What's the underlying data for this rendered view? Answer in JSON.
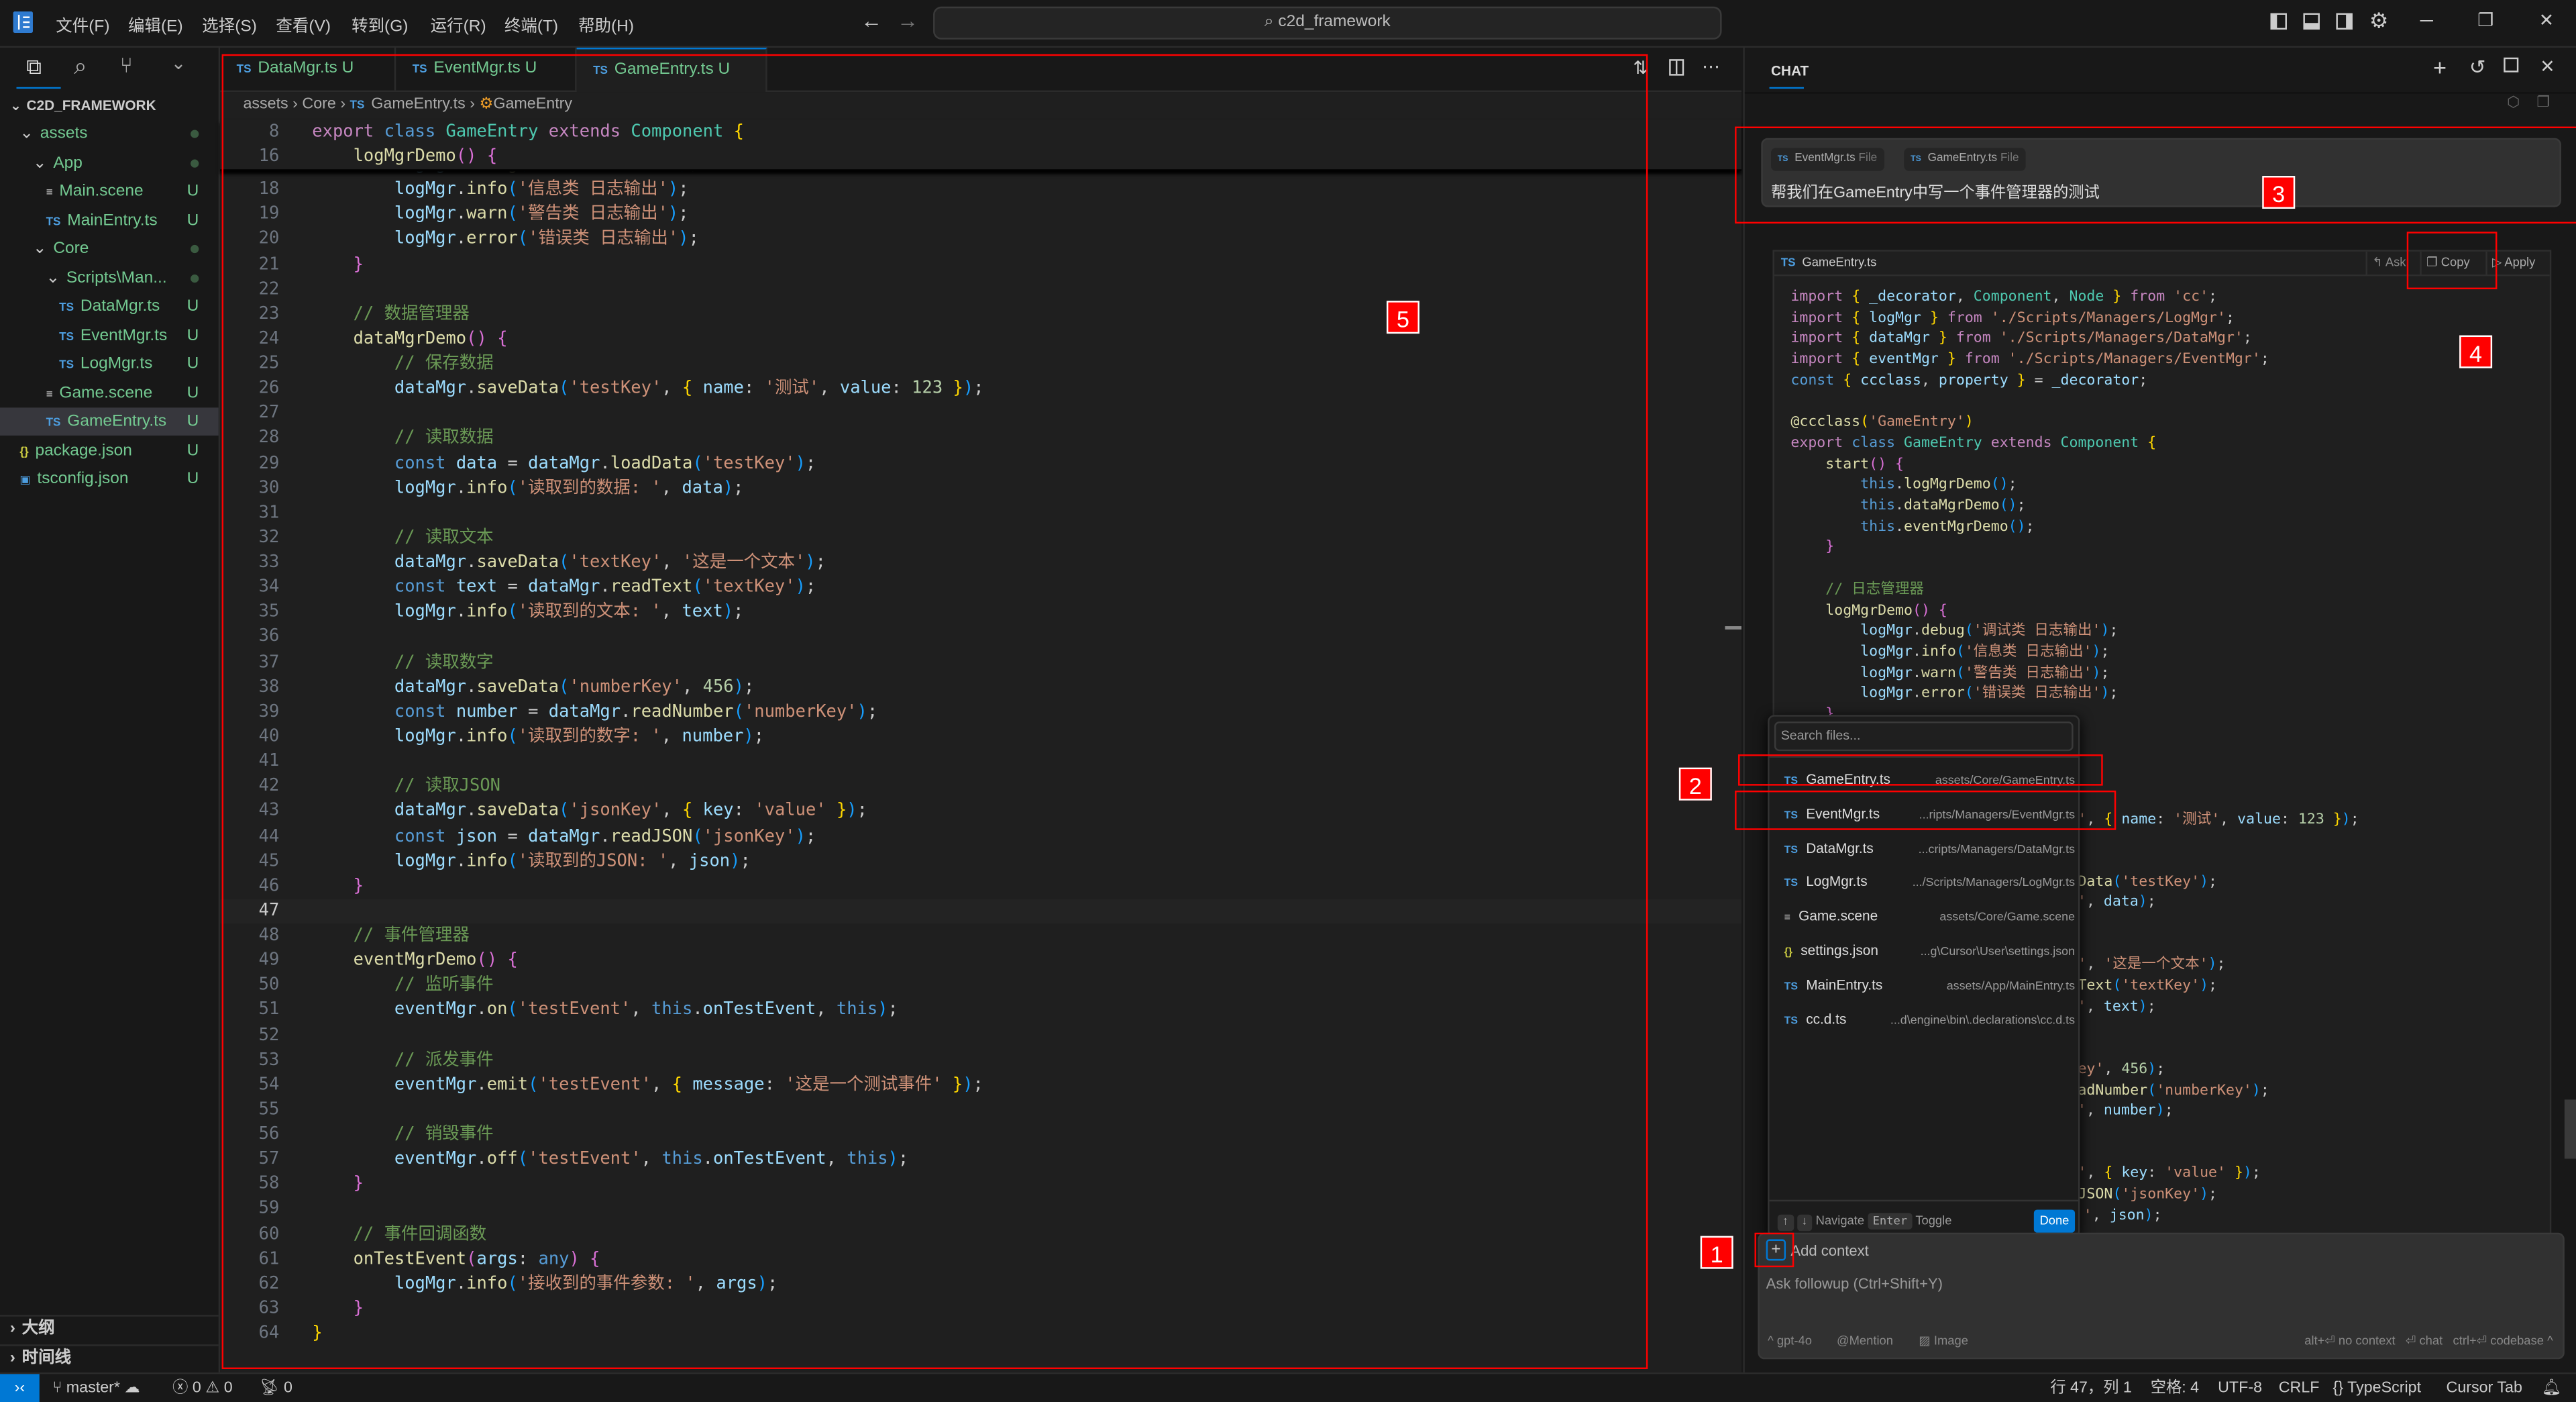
{
  "titlebar": {
    "menus": [
      "文件(F)",
      "编辑(E)",
      "选择(S)",
      "查看(V)",
      "转到(G)",
      "运行(R)",
      "终端(T)",
      "帮助(H)"
    ],
    "search": "c2d_framework"
  },
  "sidebar": {
    "root": "C2D_FRAMEWORK",
    "items": [
      {
        "label": "assets",
        "type": "folder",
        "badge": "dot"
      },
      {
        "label": "App",
        "type": "folder",
        "badge": "dot"
      },
      {
        "label": "Main.scene",
        "type": "scene",
        "badge": "U"
      },
      {
        "label": "MainEntry.ts",
        "type": "ts",
        "badge": "U"
      },
      {
        "label": "Core",
        "type": "folder",
        "badge": "dot"
      },
      {
        "label": "Scripts\\Man...",
        "type": "folder",
        "badge": "dot"
      },
      {
        "label": "DataMgr.ts",
        "type": "ts",
        "badge": "U"
      },
      {
        "label": "EventMgr.ts",
        "type": "ts",
        "badge": "U"
      },
      {
        "label": "LogMgr.ts",
        "type": "ts",
        "badge": "U"
      },
      {
        "label": "Game.scene",
        "type": "scene",
        "badge": "U"
      },
      {
        "label": "GameEntry.ts",
        "type": "ts",
        "badge": "U",
        "selected": true
      },
      {
        "label": "package.json",
        "type": "json",
        "badge": "U"
      },
      {
        "label": "tsconfig.json",
        "type": "tsconfig",
        "badge": "U"
      }
    ],
    "outline": "大纲",
    "timeline": "时间线"
  },
  "tabs": [
    {
      "label": "DataMgr.ts",
      "badge": "U"
    },
    {
      "label": "EventMgr.ts",
      "badge": "U"
    },
    {
      "label": "GameEntry.ts",
      "badge": "U",
      "active": true
    }
  ],
  "breadcrumb": [
    "assets",
    "Core",
    "GameEntry.ts",
    "GameEntry"
  ],
  "editor": {
    "sticky": [
      {
        "n": 8,
        "text": "export class GameEntry extends Component {"
      },
      {
        "n": 16,
        "text": "    logMgrDemo() {"
      }
    ],
    "first_line": 17,
    "lines": [
      "        logMgr.debug('调试类 日志输出');",
      "        logMgr.info('信息类 日志输出');",
      "        logMgr.warn('警告类 日志输出');",
      "        logMgr.error('错误类 日志输出');",
      "    }",
      "",
      "    // 数据管理器",
      "    dataMgrDemo() {",
      "        // 保存数据",
      "        dataMgr.saveData('testKey', { name: '测试', value: 123 });",
      "",
      "        // 读取数据",
      "        const data = dataMgr.loadData('testKey');",
      "        logMgr.info('读取到的数据: ', data);",
      "",
      "        // 读取文本",
      "        dataMgr.saveData('textKey', '这是一个文本');",
      "        const text = dataMgr.readText('textKey');",
      "        logMgr.info('读取到的文本: ', text);",
      "",
      "        // 读取数字",
      "        dataMgr.saveData('numberKey', 456);",
      "        const number = dataMgr.readNumber('numberKey');",
      "        logMgr.info('读取到的数字: ', number);",
      "",
      "        // 读取JSON",
      "        dataMgr.saveData('jsonKey', { key: 'value' });",
      "        const json = dataMgr.readJSON('jsonKey');",
      "        logMgr.info('读取到的JSON: ', json);",
      "    }",
      "",
      "    // 事件管理器",
      "    eventMgrDemo() {",
      "        // 监听事件",
      "        eventMgr.on('testEvent', this.onTestEvent, this);",
      "",
      "        // 派发事件",
      "        eventMgr.emit('testEvent', { message: '这是一个测试事件' });",
      "",
      "        // 销毁事件",
      "        eventMgr.off('testEvent', this.onTestEvent, this);",
      "    }",
      "",
      "    // 事件回调函数",
      "    onTestEvent(args: any) {",
      "        logMgr.info('接收到的事件参数: ', args);",
      "    }",
      "}"
    ]
  },
  "chat": {
    "title": "CHAT",
    "user_message": {
      "chips": [
        {
          "name": "EventMgr.ts",
          "kind": "File"
        },
        {
          "name": "GameEntry.ts",
          "kind": "File"
        }
      ],
      "text": "帮我们在GameEntry中写一个事件管理器的测试"
    },
    "code_block": {
      "filename": "GameEntry.ts",
      "actions": [
        "Ask",
        "Copy",
        "Apply"
      ],
      "lines": [
        "import { _decorator, Component, Node } from 'cc';",
        "import { logMgr } from './Scripts/Managers/LogMgr';",
        "import { dataMgr } from './Scripts/Managers/DataMgr';",
        "import { eventMgr } from './Scripts/Managers/EventMgr';",
        "const { ccclass, property } = _decorator;",
        "",
        "@ccclass('GameEntry')",
        "export class GameEntry extends Component {",
        "    start() {",
        "        this.logMgrDemo();",
        "        this.dataMgrDemo();",
        "        this.eventMgrDemo();",
        "    }",
        "",
        "    // 日志管理器",
        "    logMgrDemo() {",
        "        logMgr.debug('调试类 日志输出');",
        "        logMgr.info('信息类 日志输出');",
        "        logMgr.warn('警告类 日志输出');",
        "        logMgr.error('错误类 日志输出');",
        "    }",
        "",
        "    // 数据管理器",
        "    dataMgrDemo() {",
        "        // 保存数据",
        "        dataMgr.saveData('testKey', { name: '测试', value: 123 });",
        "",
        "        // 读取数据",
        "        const data = dataMgr.loadData('testKey');",
        "        logMgr.info('读取到的数据: ', data);",
        "",
        "        // 读取文本",
        "        dataMgr.saveData('textKey', '这是一个文本');",
        "        const text = dataMgr.readText('textKey');",
        "        logMgr.info('读取到的文本: ', text);",
        "",
        "        // 读取数字",
        "        dataMgr.saveData('numberKey', 456);",
        "        const number = dataMgr.readNumber('numberKey');",
        "        logMgr.info('读取到的数字: ', number);",
        "",
        "        // 读取JSON",
        "        dataMgr.saveData('jsonKey', { key: 'value' });",
        "        const json = dataMgr.readJSON('jsonKey');",
        "        logMgr.info('读取到的JSON: ', json);"
      ]
    },
    "file_picker": {
      "placeholder": "Search files...",
      "items": [
        {
          "name": "GameEntry.ts",
          "path": "assets/Core/GameEntry.ts",
          "icon": "ts"
        },
        {
          "name": "EventMgr.ts",
          "path": "...ripts/Managers/EventMgr.ts",
          "icon": "ts"
        },
        {
          "name": "DataMgr.ts",
          "path": "...cripts/Managers/DataMgr.ts",
          "icon": "ts"
        },
        {
          "name": "LogMgr.ts",
          "path": ".../Scripts/Managers/LogMgr.ts",
          "icon": "ts"
        },
        {
          "name": "Game.scene",
          "path": "assets/Core/Game.scene",
          "icon": "scene"
        },
        {
          "name": "settings.json",
          "path": "...g\\Cursor\\User\\settings.json",
          "icon": "json"
        },
        {
          "name": "MainEntry.ts",
          "path": "assets/App/MainEntry.ts",
          "icon": "ts"
        },
        {
          "name": "cc.d.ts",
          "path": "...d\\engine\\bin\\.declarations\\cc.d.ts",
          "icon": "ts"
        }
      ],
      "footer": {
        "up": "↑",
        "down": "↓",
        "navigate": "Navigate",
        "enter": "Enter",
        "toggle": "Toggle",
        "done": "Done"
      }
    },
    "input": {
      "add_context": "Add context",
      "placeholder": "Ask followup (Ctrl+Shift+Y)",
      "model": "gpt-4o",
      "mention": "Mention",
      "image": "Image",
      "no_context": "alt+⏎ no context",
      "chat": "⏎ chat",
      "codebase": "ctrl+⏎ codebase"
    }
  },
  "annotations": [
    "1",
    "2",
    "3",
    "4",
    "5"
  ],
  "statusbar": {
    "branch": "master*",
    "errors": "0",
    "warnings": "0",
    "ports": "0",
    "position": "行 47，列 1",
    "spaces": "空格: 4",
    "encoding": "UTF-8",
    "eol": "CRLF",
    "language": "TypeScript",
    "cursor_tab": "Cursor Tab"
  },
  "colors": {
    "accent": "#0078d4",
    "annotation": "#ff0000",
    "untracked": "#73c991"
  }
}
